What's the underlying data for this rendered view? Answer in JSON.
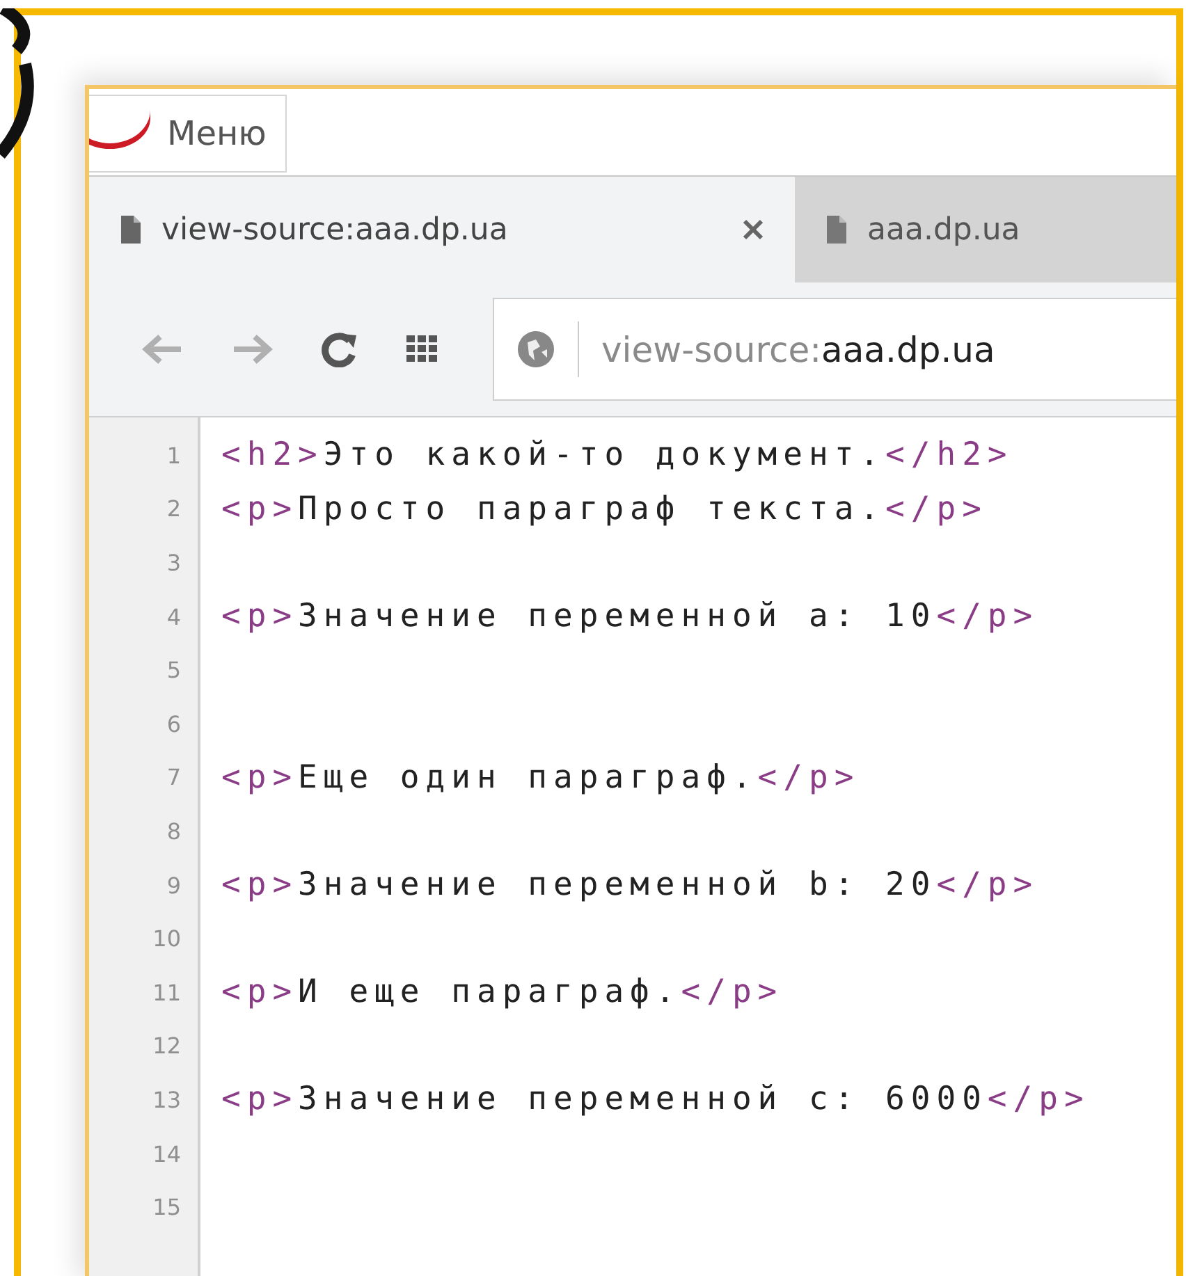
{
  "menu": {
    "label": "Меню"
  },
  "tabs": [
    {
      "title": "view-source:aaa.dp.ua",
      "selected": true,
      "closable": true
    },
    {
      "title": "aaa.dp.ua",
      "selected": false,
      "closable": false
    }
  ],
  "address": {
    "scheme": "view-source:",
    "host": "aaa.dp.ua"
  },
  "lines": [
    {
      "number": "1",
      "segments": [
        {
          "kind": "tag",
          "text": "<h2>"
        },
        {
          "kind": "text",
          "text": "Это какой-то документ."
        },
        {
          "kind": "tag",
          "text": "</h2>"
        }
      ]
    },
    {
      "number": "2",
      "segments": [
        {
          "kind": "tag",
          "text": "<p>"
        },
        {
          "kind": "text",
          "text": "Просто параграф текста."
        },
        {
          "kind": "tag",
          "text": "</p>"
        }
      ]
    },
    {
      "number": "3"
    },
    {
      "number": "4",
      "segments": [
        {
          "kind": "tag",
          "text": "<p>"
        },
        {
          "kind": "text",
          "text": "Значение переменной a: 10"
        },
        {
          "kind": "tag",
          "text": "</p>"
        }
      ]
    },
    {
      "number": "5"
    },
    {
      "number": "6"
    },
    {
      "number": "7",
      "segments": [
        {
          "kind": "tag",
          "text": "<p>"
        },
        {
          "kind": "text",
          "text": "Еще один параграф."
        },
        {
          "kind": "tag",
          "text": "</p>"
        }
      ]
    },
    {
      "number": "8"
    },
    {
      "number": "9",
      "segments": [
        {
          "kind": "tag",
          "text": "<p>"
        },
        {
          "kind": "text",
          "text": "Значение переменной b: 20"
        },
        {
          "kind": "tag",
          "text": "</p>"
        }
      ]
    },
    {
      "number": "10"
    },
    {
      "number": "11",
      "segments": [
        {
          "kind": "tag",
          "text": "<p>"
        },
        {
          "kind": "text",
          "text": "И еще параграф."
        },
        {
          "kind": "tag",
          "text": "</p>"
        }
      ]
    },
    {
      "number": "12"
    },
    {
      "number": "13",
      "segments": [
        {
          "kind": "tag",
          "text": "<p>"
        },
        {
          "kind": "text",
          "text": "Значение переменной c: 6000"
        },
        {
          "kind": "tag",
          "text": "</p>"
        }
      ]
    },
    {
      "number": "14"
    },
    {
      "number": "15"
    }
  ]
}
